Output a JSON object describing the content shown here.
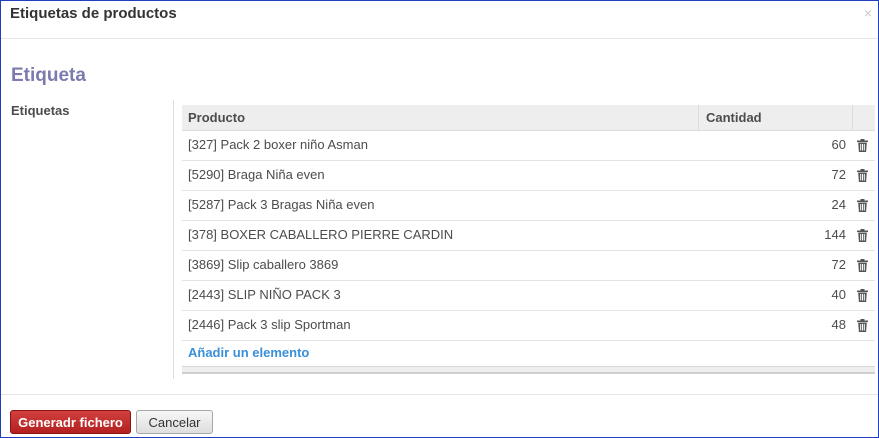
{
  "dialog": {
    "title": "Etiquetas de productos",
    "close_glyph": "×"
  },
  "form": {
    "section_title": "Etiqueta",
    "field_label": "Etiquetas"
  },
  "table": {
    "headers": {
      "product": "Producto",
      "quantity": "Cantidad"
    },
    "rows": [
      {
        "product": "[327] Pack 2 boxer niño Asman",
        "quantity": "60"
      },
      {
        "product": "[5290] Braga Niña even",
        "quantity": "72"
      },
      {
        "product": "[5287] Pack 3 Bragas Niña even",
        "quantity": "24"
      },
      {
        "product": "[378] BOXER CABALLERO PIERRE CARDIN",
        "quantity": "144"
      },
      {
        "product": "[3869] Slip caballero 3869",
        "quantity": "72"
      },
      {
        "product": "[2443] SLIP NIÑO PACK 3",
        "quantity": "40"
      },
      {
        "product": "[2446] Pack 3 slip Sportman",
        "quantity": "48"
      }
    ],
    "add_label": "Añadir un elemento",
    "row_action_icon": "trash-icon"
  },
  "buttons": {
    "generate_label": "Generadr fichero",
    "cancel_label": "Cancelar"
  },
  "colors": {
    "section_title": "#7c7bad",
    "link": "#3a8fd8",
    "primary_button": "#c12e2e",
    "dialog_border": "#1f3fbf"
  }
}
